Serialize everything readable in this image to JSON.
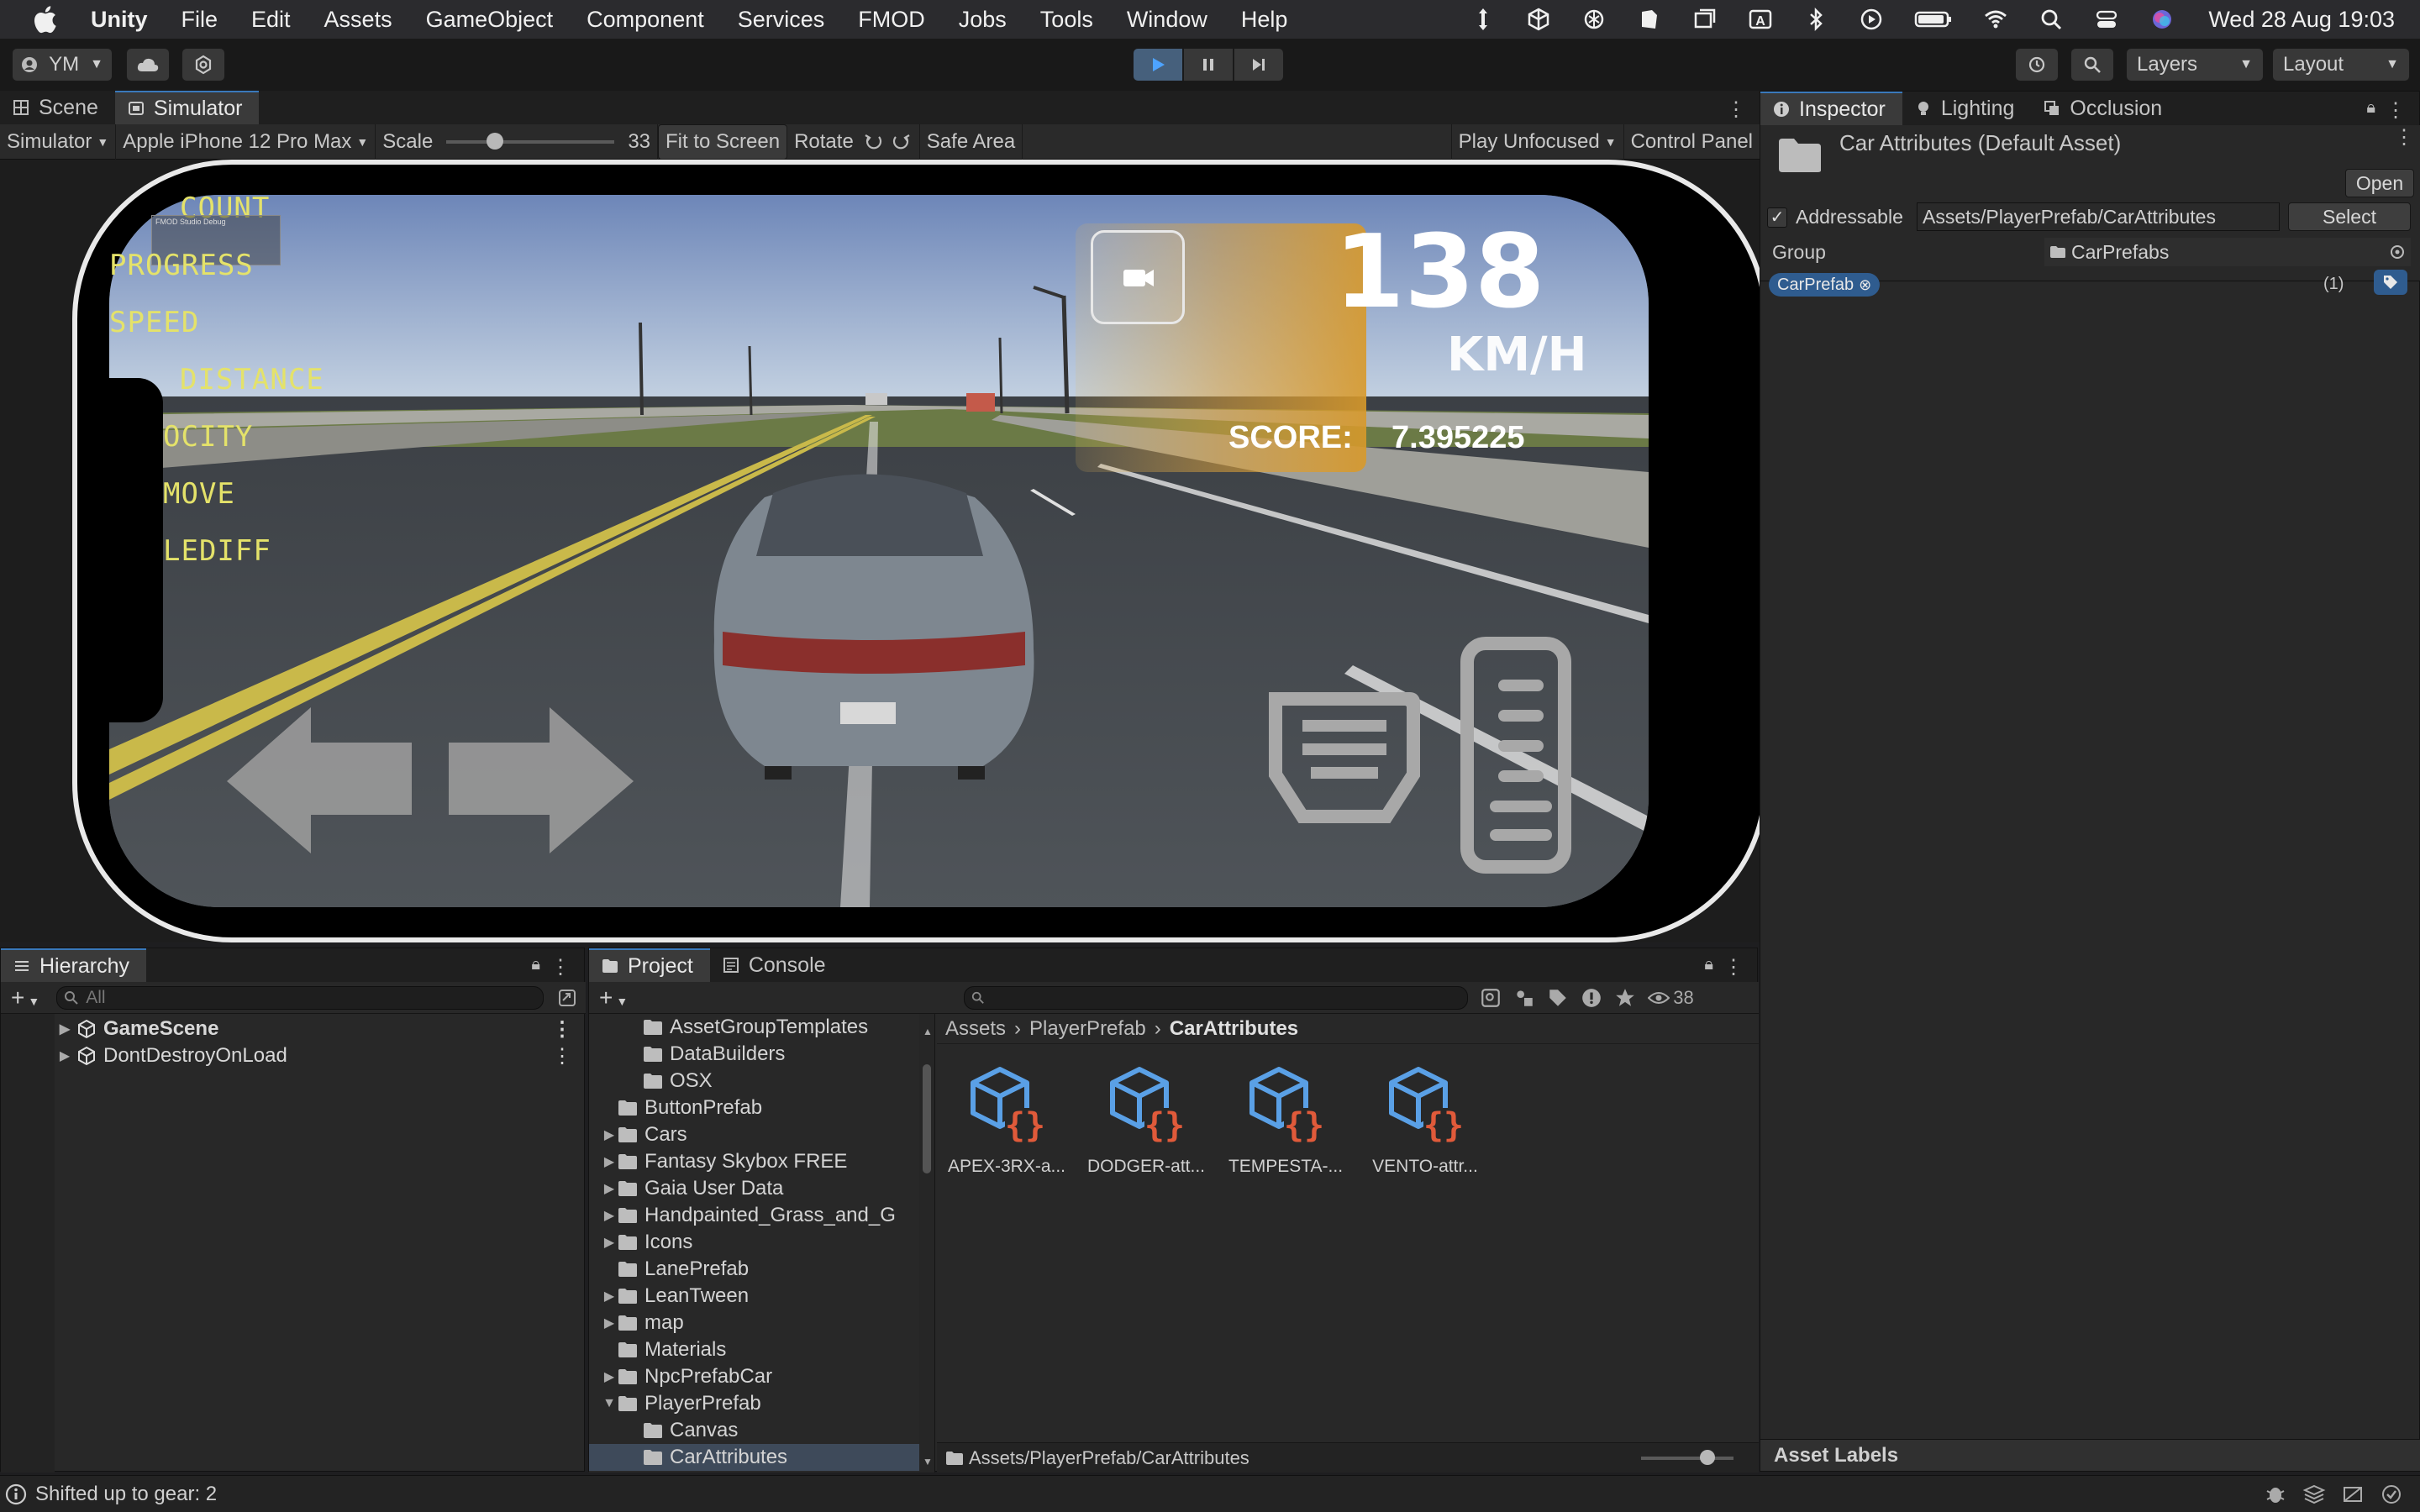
{
  "menubar": {
    "app": "Unity",
    "items": [
      "File",
      "Edit",
      "Assets",
      "GameObject",
      "Component",
      "Services",
      "FMOD",
      "Jobs",
      "Tools",
      "Window",
      "Help"
    ],
    "clock": "Wed 28 Aug  19:03"
  },
  "toolbar": {
    "account": "YM",
    "layers": "Layers",
    "layout": "Layout"
  },
  "simulator": {
    "tabs": [
      "Scene",
      "Simulator"
    ],
    "mode": "Simulator",
    "device": "Apple iPhone 12 Pro Max",
    "scale_label": "Scale",
    "scale_value": "33",
    "fit": "Fit to Screen",
    "rotate": "Rotate",
    "safe_area": "Safe Area",
    "play_mode": "Play Unfocused",
    "control_panel": "Control Panel"
  },
  "game": {
    "hud_labels": [
      "COUNT",
      "PROGRESS",
      "SPEED",
      "DISTANCE",
      "OCITY",
      "MOVE",
      "LEDIFF"
    ],
    "speed": "138",
    "speed_unit": "KM/H",
    "score_label": "SCORE:",
    "score_value": "7.395225",
    "fmod_title": "FMOD Studio Debug"
  },
  "inspector": {
    "tabs": [
      "Inspector",
      "Lighting",
      "Occlusion"
    ],
    "title": "Car Attributes (Default Asset)",
    "open": "Open",
    "addressable_label": "Addressable",
    "address": "Assets/PlayerPrefab/CarAttributes",
    "select": "Select",
    "group_label": "Group",
    "group_value": "CarPrefabs",
    "label_chip": "CarPrefab",
    "label_count": "(1)",
    "asset_labels": "Asset Labels"
  },
  "hierarchy": {
    "tab": "Hierarchy",
    "search_placeholder": "All",
    "items": [
      "GameScene",
      "DontDestroyOnLoad"
    ]
  },
  "project": {
    "tabs": [
      "Project",
      "Console"
    ],
    "hidden_count": "38",
    "tree": [
      {
        "label": "AssetGroupTemplates",
        "indent": 2,
        "arrow": ""
      },
      {
        "label": "DataBuilders",
        "indent": 2,
        "arrow": ""
      },
      {
        "label": "OSX",
        "indent": 2,
        "arrow": ""
      },
      {
        "label": "ButtonPrefab",
        "indent": 1,
        "arrow": ""
      },
      {
        "label": "Cars",
        "indent": 1,
        "arrow": "▶"
      },
      {
        "label": "Fantasy Skybox FREE",
        "indent": 1,
        "arrow": "▶"
      },
      {
        "label": "Gaia User Data",
        "indent": 1,
        "arrow": "▶"
      },
      {
        "label": "Handpainted_Grass_and_G",
        "indent": 1,
        "arrow": "▶"
      },
      {
        "label": "Icons",
        "indent": 1,
        "arrow": "▶"
      },
      {
        "label": "LanePrefab",
        "indent": 1,
        "arrow": ""
      },
      {
        "label": "LeanTween",
        "indent": 1,
        "arrow": "▶"
      },
      {
        "label": "map",
        "indent": 1,
        "arrow": "▶"
      },
      {
        "label": "Materials",
        "indent": 1,
        "arrow": ""
      },
      {
        "label": "NpcPrefabCar",
        "indent": 1,
        "arrow": "▶"
      },
      {
        "label": "PlayerPrefab",
        "indent": 1,
        "arrow": "▼"
      },
      {
        "label": "Canvas",
        "indent": 2,
        "arrow": ""
      },
      {
        "label": "CarAttributes",
        "indent": 2,
        "arrow": "",
        "selected": true
      }
    ],
    "breadcrumb": [
      "Assets",
      "PlayerPrefab",
      "CarAttributes"
    ],
    "assets": [
      "APEX-3RX-a...",
      "DODGER-att...",
      "TEMPESTA-...",
      "VENTO-attr..."
    ],
    "path": "Assets/PlayerPrefab/CarAttributes"
  },
  "status": {
    "message": "Shifted up to gear: 2"
  },
  "colors": {
    "accent": "#3a79bb",
    "hud_yellow": "#e4e26a",
    "speed_panel": "#d89a2a",
    "script_icon_blue": "#5aa0e6",
    "script_icon_red": "#e05a3a"
  }
}
